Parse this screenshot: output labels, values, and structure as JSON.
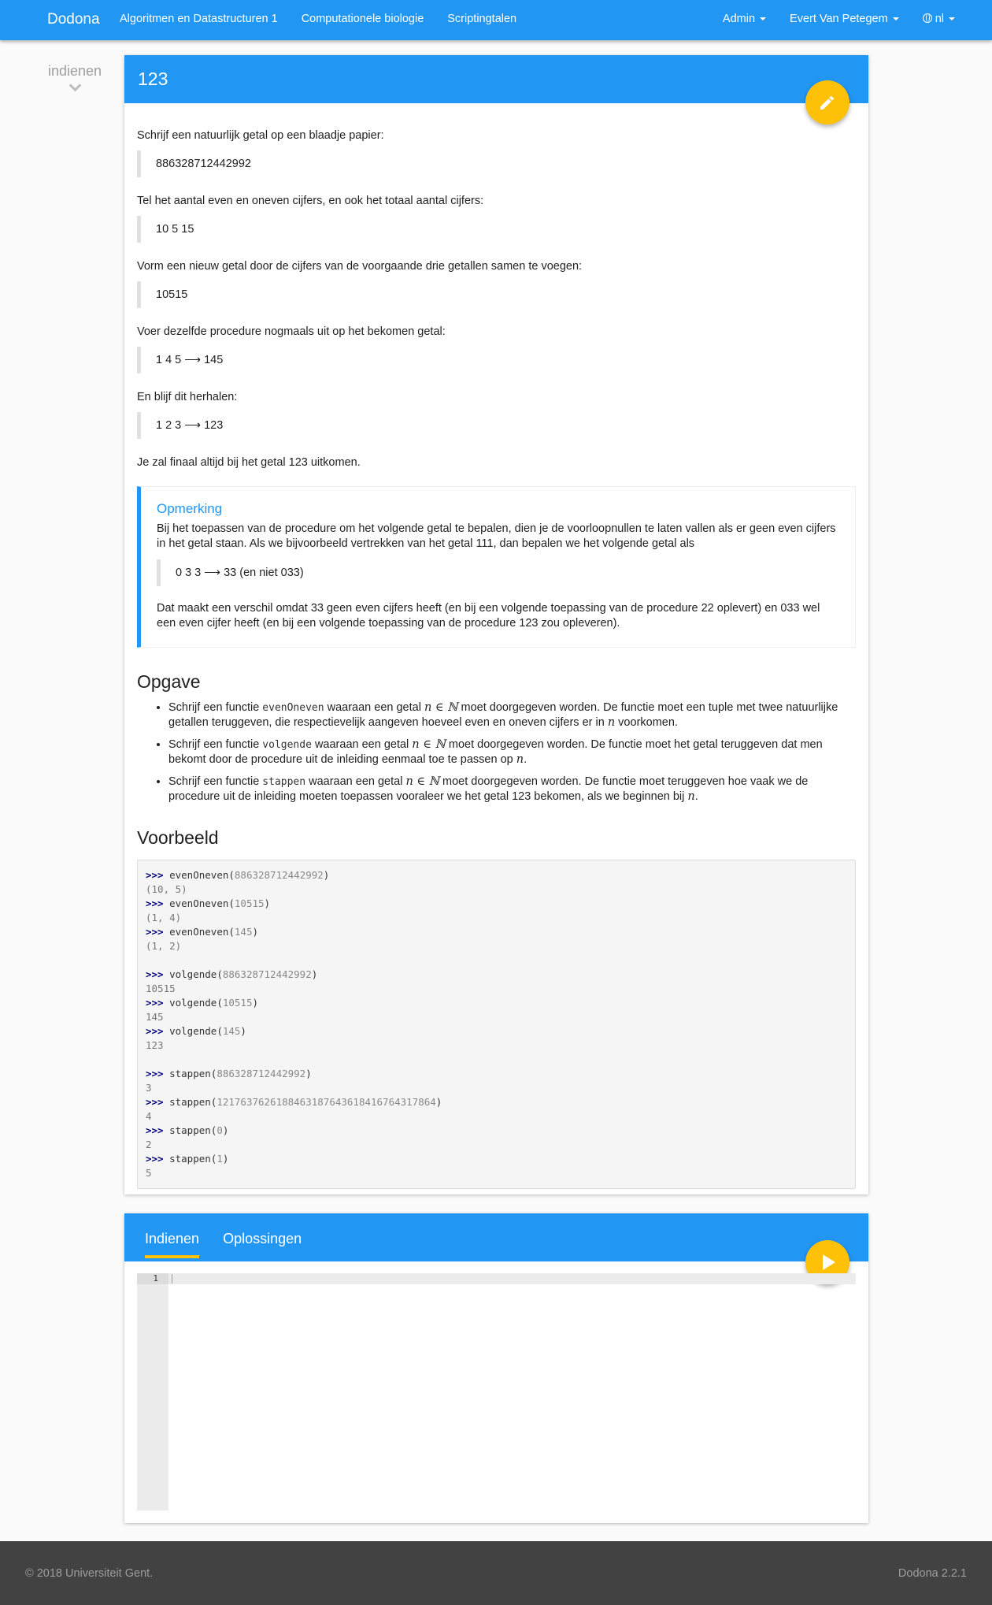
{
  "nav": {
    "brand": "Dodona",
    "links": [
      "Algoritmen en Datastructuren 1",
      "Computationele biologie",
      "Scriptingtalen"
    ],
    "admin": "Admin",
    "user": "Evert Van Petegem",
    "lang": "nl"
  },
  "sidebar": {
    "submit_label": "indienen"
  },
  "exercise": {
    "title": "123",
    "intro": [
      {
        "text": "Schrijf een natuurlijk getal op een blaadje papier:",
        "quote": "886328712442992"
      },
      {
        "text": "Tel het aantal even en oneven cijfers, en ook het totaal aantal cijfers:",
        "quote": "10 5 15"
      },
      {
        "text": "Vorm een nieuw getal door de cijfers van de voorgaande drie getallen samen te voegen:",
        "quote": "10515"
      },
      {
        "text": "Voer dezelfde procedure nogmaals uit op het bekomen getal:",
        "quote": "1 4 5 ⟶ 145"
      },
      {
        "text": "En blijf dit herhalen:",
        "quote": "1 2 3 ⟶ 123"
      }
    ],
    "conclusion": "Je zal finaal altijd bij het getal 123 uitkomen.",
    "note": {
      "title": "Opmerking",
      "p1": "Bij het toepassen van de procedure om het volgende getal te bepalen, dien je de voorloopnullen te laten vallen als er geen even cijfers in het getal staan. Als we bijvoorbeeld vertrekken van het getal 111, dan bepalen we het volgende getal als",
      "quote": "0 3 3 ⟶ 33 (en niet 033)",
      "p2": "Dat maakt een verschil omdat 33 geen even cijfers heeft (en bij een volgende toepassing van de procedure 22 oplevert) en 033 wel een even cijfer heeft (en bij een volgende toepassing van de procedure 123 zou opleveren)."
    },
    "opgave": {
      "heading": "Opgave",
      "items": [
        {
          "a": "Schrijf een functie ",
          "code": "evenOneven",
          "b": " waaraan een getal ",
          "m": "n ∈ ℕ",
          "c": " moet doorgegeven worden. De functie moet een tuple met twee natuurlijke getallen teruggeven, die respectievelijk aangeven hoeveel even en oneven cijfers er in ",
          "m2": "n",
          "d": " voorkomen."
        },
        {
          "a": "Schrijf een functie ",
          "code": "volgende",
          "b": " waaraan een getal ",
          "m": "n ∈ ℕ",
          "c": " moet doorgegeven worden. De functie moet het getal teruggeven dat men bekomt door de procedure uit de inleiding eenmaal toe te passen op ",
          "m2": "n",
          "d": "."
        },
        {
          "a": "Schrijf een functie ",
          "code": "stappen",
          "b": " waaraan een getal ",
          "m": "n ∈ ℕ",
          "c": " moet doorgegeven worden. De functie moet teruggeven hoe vaak we de procedure uit de inleiding moeten toepassen vooraleer we het getal 123 bekomen, als we beginnen bij ",
          "m2": "n",
          "d": "."
        }
      ]
    },
    "voorbeeld": {
      "heading": "Voorbeeld",
      "lines": [
        {
          "t": "in",
          "f": "evenOneven",
          "arg": "886328712442992"
        },
        {
          "t": "out",
          "v": "(10, 5)"
        },
        {
          "t": "in",
          "f": "evenOneven",
          "arg": "10515"
        },
        {
          "t": "out",
          "v": "(1, 4)"
        },
        {
          "t": "in",
          "f": "evenOneven",
          "arg": "145"
        },
        {
          "t": "out",
          "v": "(1, 2)"
        },
        {
          "t": "blank"
        },
        {
          "t": "in",
          "f": "volgende",
          "arg": "886328712442992"
        },
        {
          "t": "out",
          "v": "10515"
        },
        {
          "t": "in",
          "f": "volgende",
          "arg": "10515"
        },
        {
          "t": "out",
          "v": "145"
        },
        {
          "t": "in",
          "f": "volgende",
          "arg": "145"
        },
        {
          "t": "out",
          "v": "123"
        },
        {
          "t": "blank"
        },
        {
          "t": "in",
          "f": "stappen",
          "arg": "886328712442992"
        },
        {
          "t": "out",
          "v": "3"
        },
        {
          "t": "in",
          "f": "stappen",
          "arg": "1217637626188463187643618416764317864"
        },
        {
          "t": "out",
          "v": "4"
        },
        {
          "t": "in",
          "f": "stappen",
          "arg": "0"
        },
        {
          "t": "out",
          "v": "2"
        },
        {
          "t": "in",
          "f": "stappen",
          "arg": "1"
        },
        {
          "t": "out",
          "v": "5"
        }
      ],
      "prompt": ">>>"
    }
  },
  "submit": {
    "tabs": [
      "Indienen",
      "Oplossingen"
    ],
    "line_number": "1"
  },
  "footer": {
    "copyright": "© 2018 Universiteit Gent.",
    "version": "Dodona 2.2.1"
  },
  "colors": {
    "primary": "#2196f3",
    "accent": "#ffc107"
  }
}
